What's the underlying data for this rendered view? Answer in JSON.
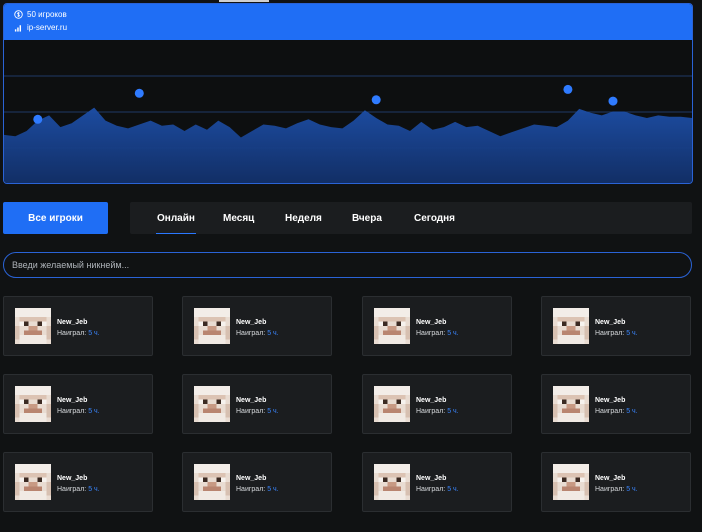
{
  "server": {
    "players_text": "50 игроков",
    "address": "ip-server.ru"
  },
  "colors": {
    "accent": "#1f6ef5",
    "chart_fill": "#1d4fa8",
    "background": "#101213",
    "card": "#1b1d1f"
  },
  "chart_data": {
    "type": "area",
    "y": [
      37,
      36,
      40,
      48,
      52,
      43,
      46,
      52,
      58,
      48,
      44,
      42,
      45,
      48,
      44,
      45,
      40,
      45,
      41,
      48,
      43,
      35,
      40,
      45,
      44,
      42,
      46,
      49,
      45,
      43,
      42,
      48,
      56,
      50,
      45,
      44,
      40,
      47,
      41,
      43,
      47,
      43,
      44,
      40,
      36,
      39,
      42,
      45,
      44,
      43,
      48,
      57,
      54,
      52,
      55,
      55,
      52,
      50,
      52,
      51,
      51,
      50
    ],
    "highlighted_points": [
      {
        "index": 3,
        "value": 49
      },
      {
        "index": 12,
        "value": 69
      },
      {
        "index": 33,
        "value": 64
      },
      {
        "index": 50,
        "value": 72
      },
      {
        "index": 54,
        "value": 63
      }
    ],
    "ylim": [
      0,
      110
    ],
    "grid": "horizontal"
  },
  "filters": {
    "all_players": "Все игроки",
    "tabs": [
      "Онлайн",
      "Месяц",
      "Неделя",
      "Вчера",
      "Сегодня"
    ],
    "active_tab": "Онлайн"
  },
  "search": {
    "placeholder": "Введи желаемый никнейм..."
  },
  "players": [
    {
      "name": "New_Jeb",
      "played_label": "Наиграл:",
      "hours": "5 ч."
    },
    {
      "name": "New_Jeb",
      "played_label": "Наиграл:",
      "hours": "5 ч."
    },
    {
      "name": "New_Jeb",
      "played_label": "Наиграл:",
      "hours": "5 ч."
    },
    {
      "name": "New_Jeb",
      "played_label": "Наиграл:",
      "hours": "5 ч."
    },
    {
      "name": "New_Jeb",
      "played_label": "Наиграл:",
      "hours": "5 ч."
    },
    {
      "name": "New_Jeb",
      "played_label": "Наиграл:",
      "hours": "5 ч."
    },
    {
      "name": "New_Jeb",
      "played_label": "Наиграл:",
      "hours": "5 ч."
    },
    {
      "name": "New_Jeb",
      "played_label": "Наиграл:",
      "hours": "5 ч."
    },
    {
      "name": "New_Jeb",
      "played_label": "Наиграл:",
      "hours": "5 ч."
    },
    {
      "name": "New_Jeb",
      "played_label": "Наиграл:",
      "hours": "5 ч."
    },
    {
      "name": "New_Jeb",
      "played_label": "Наиграл:",
      "hours": "5 ч."
    },
    {
      "name": "New_Jeb",
      "played_label": "Наиграл:",
      "hours": "5 ч."
    }
  ]
}
